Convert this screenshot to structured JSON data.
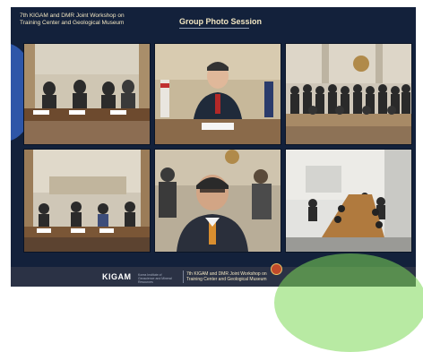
{
  "header": {
    "event_line1": "7th KIGAM and DMR Joint Workshop on",
    "event_line2": "Training Center and Geological Museum",
    "session_title": "Group Photo Session"
  },
  "video_tiles": [
    {
      "scene": "conference-room-row-of-participants-at-desk"
    },
    {
      "scene": "speaker-at-desk-with-flags"
    },
    {
      "scene": "large-group-standing-in-hall"
    },
    {
      "scene": "participants-at-long-table"
    },
    {
      "scene": "speaker-close-up-with-audience"
    },
    {
      "scene": "meeting-room-with-long-table"
    }
  ],
  "footer": {
    "logo": "KIGAM",
    "logo_sub": "Korea Institute of Geoscience and Mineral Resources",
    "event_line1": "7th KIGAM and DMR Joint Workshop on",
    "event_line2": "Training Center and Geological Museum"
  },
  "colors": {
    "background": "#13213b",
    "title_text": "#f2e6c2",
    "accent_blue": "#2e56a8",
    "accent_green": "#7ed957",
    "footer_bar": "#2b3245"
  }
}
